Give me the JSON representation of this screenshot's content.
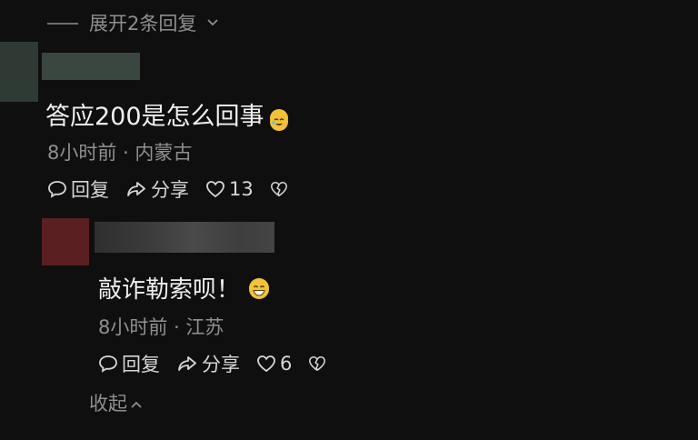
{
  "top": {
    "expand_label": "展开2条回复"
  },
  "comment1": {
    "text": "答应200是怎么回事",
    "meta": "8小时前 · 内蒙古",
    "reply_label": "回复",
    "share_label": "分享",
    "like_count": "13"
  },
  "comment2": {
    "text": "敲诈勒索呗！",
    "meta": "8小时前 · 江苏",
    "reply_label": "回复",
    "share_label": "分享",
    "like_count": "6"
  },
  "bottom": {
    "collapse_label": "收起"
  },
  "icons": {
    "reply": "speech-bubble-icon",
    "share": "share-arrow-icon",
    "like": "heart-icon",
    "dislike": "broken-heart-icon",
    "expand": "chevron-down-icon",
    "collapse": "chevron-up-icon"
  }
}
